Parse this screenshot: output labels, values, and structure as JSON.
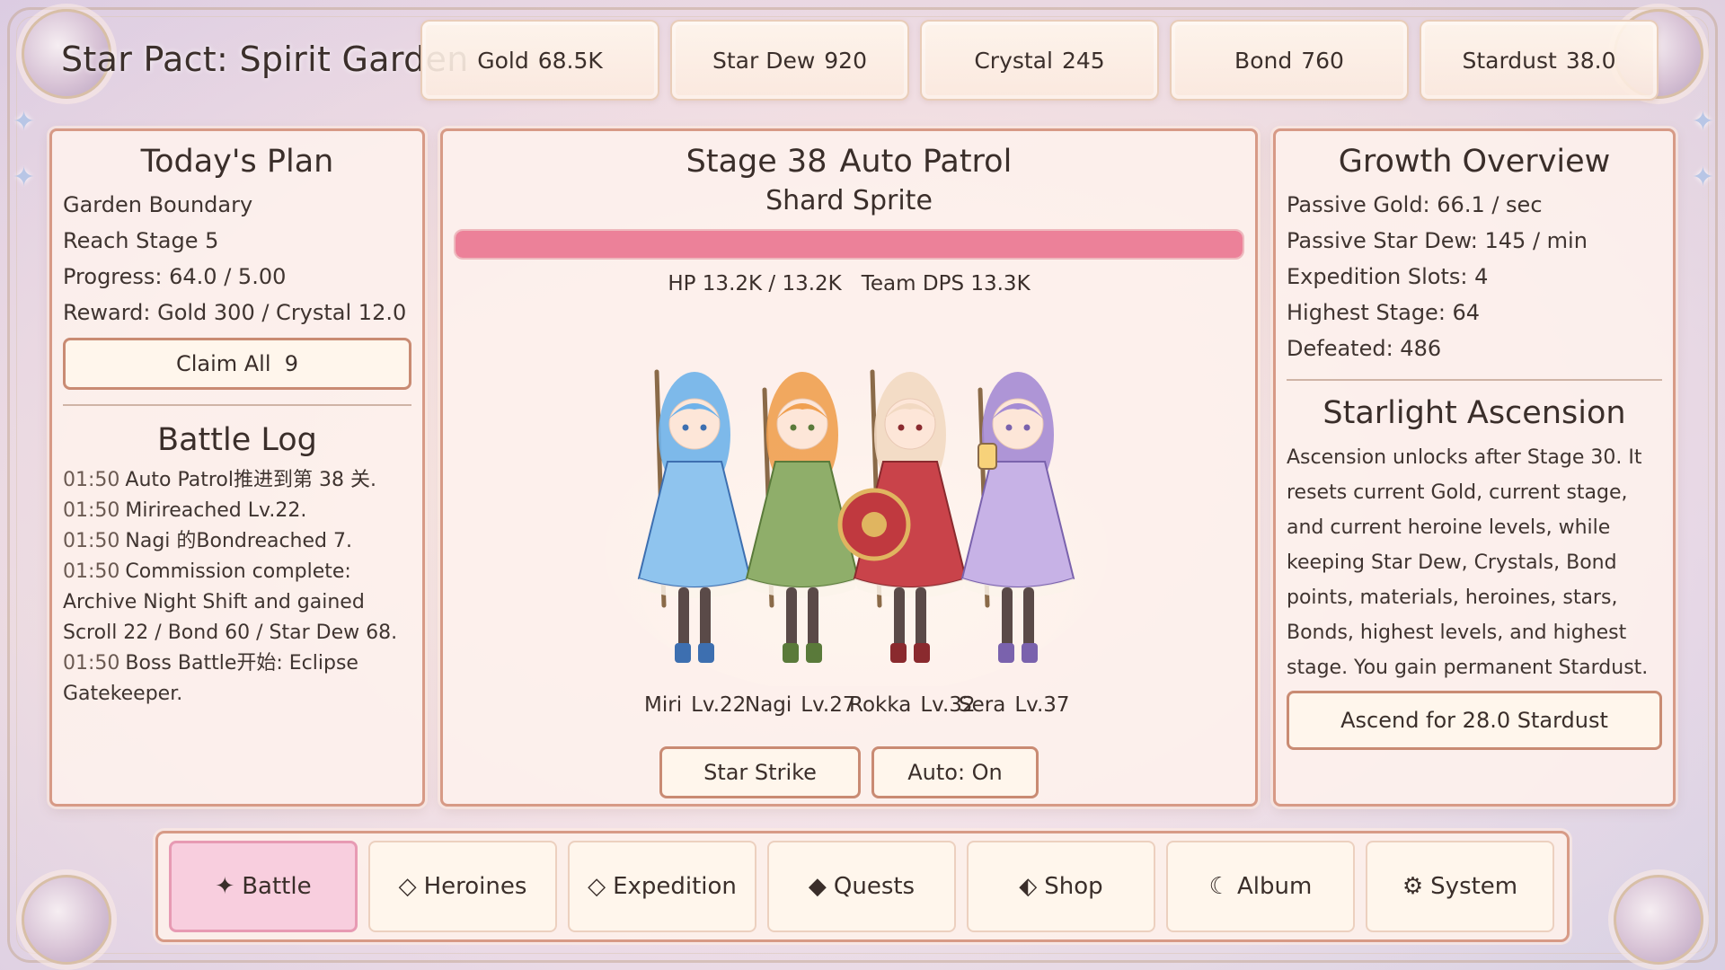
{
  "game": {
    "title": "Star Pact: Spirit Garden"
  },
  "resources": [
    {
      "name": "Gold",
      "value": "68.5K"
    },
    {
      "name": "Star Dew",
      "value": "920"
    },
    {
      "name": "Crystal",
      "value": "245"
    },
    {
      "name": "Bond",
      "value": "760"
    },
    {
      "name": "Stardust",
      "value": "38.0"
    }
  ],
  "plan": {
    "title": "Today's Plan",
    "lines": [
      "Garden Boundary",
      "Reach Stage 5",
      "Progress: 64.0 / 5.00",
      "Reward: Gold 300 / Crystal 12.0"
    ],
    "claim_label": "Claim All",
    "claim_count": "9"
  },
  "log": {
    "title": "Battle Log",
    "entries": [
      {
        "time": "01:50",
        "text": "Auto Patrol推进到第 38 关."
      },
      {
        "time": "01:50",
        "text": "Mirireached Lv.22."
      },
      {
        "time": "01:50",
        "text": "Nagi 的Bondreached 7."
      },
      {
        "time": "01:50",
        "text": "Commission complete: Archive Night Shift and gained  Scroll 22 / Bond 60 / Star Dew 68."
      },
      {
        "time": "01:50",
        "text": "Boss Battle开始: Eclipse Gatekeeper."
      }
    ]
  },
  "battle": {
    "stage": "Stage 38",
    "mode": "Auto Patrol",
    "enemy": "Shard Sprite",
    "hp_fraction": 1.0,
    "hp_text": "HP 13.2K / 13.2K",
    "dps_text": "Team DPS 13.3K",
    "heroes": [
      {
        "name": "Miri",
        "level": "Lv.22",
        "dress": "#8fc4ee",
        "hair": "#6fb2ea",
        "accent": "#3d6fb0"
      },
      {
        "name": "Nagi",
        "level": "Lv.27",
        "dress": "#8fae6a",
        "hair": "#f0a050",
        "accent": "#5a7a3a"
      },
      {
        "name": "Rokka",
        "level": "Lv.32",
        "dress": "#c9434a",
        "hair": "#f2d9c2",
        "accent": "#8a2a2e"
      },
      {
        "name": "Sera",
        "level": "Lv.37",
        "dress": "#c7b2e6",
        "hair": "#a58bd4",
        "accent": "#7a62ad"
      }
    ],
    "star_strike_label": "Star Strike",
    "auto_label": "Auto: On"
  },
  "growth": {
    "title": "Growth Overview",
    "lines": [
      "Passive Gold: 66.1 / sec",
      "Passive Star Dew: 145 / min",
      "Expedition Slots: 4",
      "Highest Stage: 64",
      "Defeated: 486"
    ]
  },
  "ascension": {
    "title": "Starlight Ascension",
    "description": "Ascension unlocks after Stage 30. It resets current Gold, current stage, and current heroine levels, while keeping Star Dew, Crystals, Bond points, materials, heroines, stars, Bonds, highest levels, and highest stage. You gain permanent Stardust.",
    "button_label": "Ascend for 28.0 Stardust"
  },
  "nav": {
    "active": "Battle",
    "tabs": [
      {
        "glyph": "✦",
        "label": "Battle",
        "icon": "star-icon"
      },
      {
        "glyph": "◇",
        "label": "Heroines",
        "icon": "diamond-outline-icon"
      },
      {
        "glyph": "◇",
        "label": "Expedition",
        "icon": "diamond-outline-icon"
      },
      {
        "glyph": "◆",
        "label": "Quests",
        "icon": "diamond-solid-icon"
      },
      {
        "glyph": "⬖",
        "label": "Shop",
        "icon": "half-diamond-icon"
      },
      {
        "glyph": "☾",
        "label": "Album",
        "icon": "moon-icon"
      },
      {
        "glyph": "⚙",
        "label": "System",
        "icon": "gear-icon"
      }
    ]
  },
  "colors": {
    "panel_border": "#d79a86",
    "hp_fill": "#ec8199",
    "active_tab": "#f8cede"
  }
}
